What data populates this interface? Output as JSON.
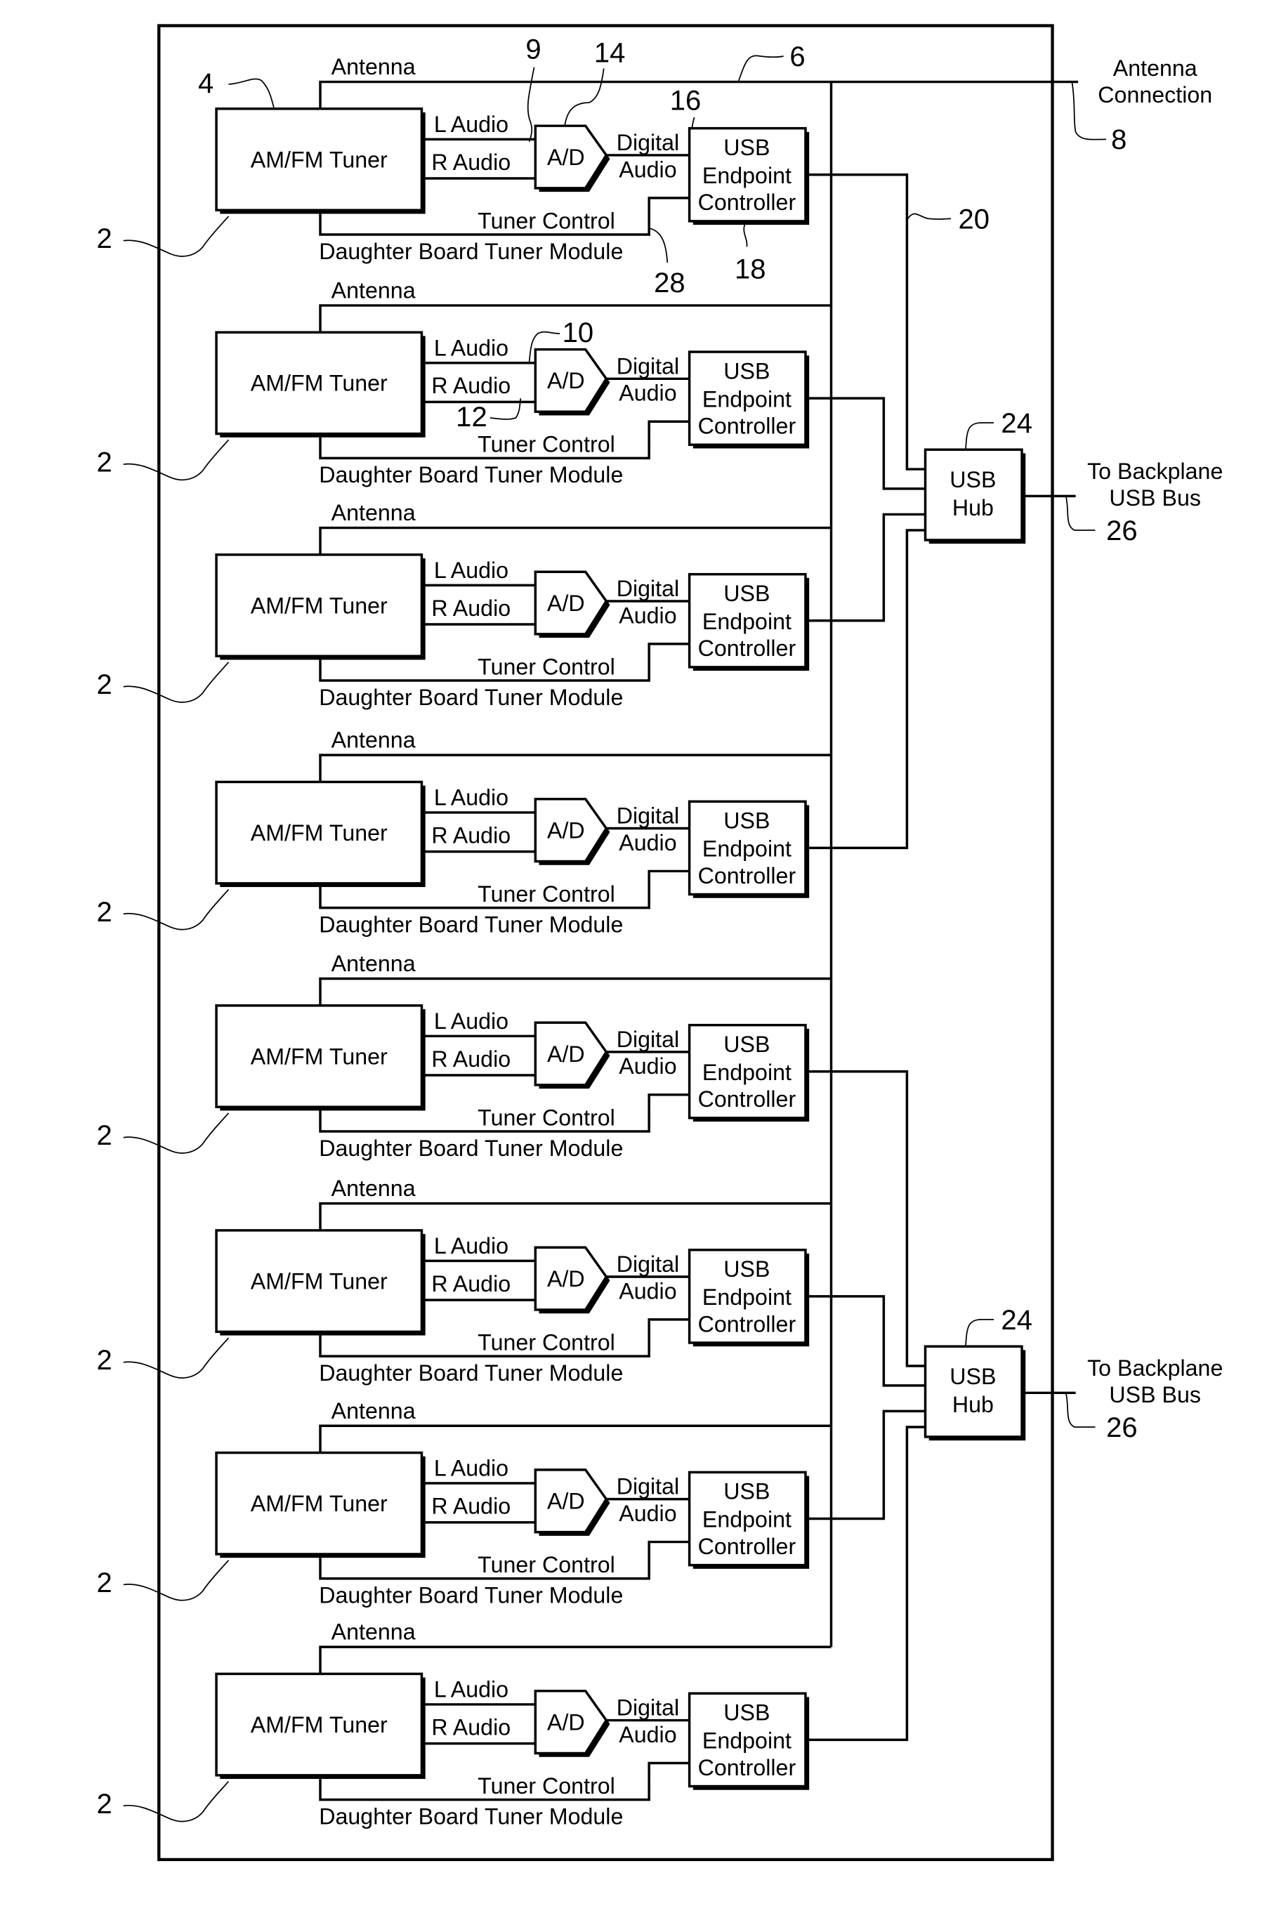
{
  "figure": {
    "module_count": 8,
    "module": {
      "tuner_label": "AM/FM Tuner",
      "antenna_label": "Antenna",
      "l_audio_label": "L Audio",
      "r_audio_label": "R Audio",
      "ad_label": "A/D",
      "digital_audio_label_line1": "Digital",
      "digital_audio_label_line2": "Audio",
      "usb_ec_line1": "USB",
      "usb_ec_line2": "Endpoint",
      "usb_ec_line3": "Controller",
      "tuner_control_label": "Tuner Control",
      "module_label": "Daughter Board Tuner Module",
      "module_ref": "2"
    },
    "hubs": [
      {
        "line1": "USB",
        "line2": "Hub",
        "ref": "24",
        "out_line1": "To Backplane",
        "out_line2": "USB Bus",
        "out_ref": "26",
        "connected_modules": [
          1,
          2,
          3,
          4
        ]
      },
      {
        "line1": "USB",
        "line2": "Hub",
        "ref": "24",
        "out_line1": "To Backplane",
        "out_line2": "USB Bus",
        "out_ref": "26",
        "connected_modules": [
          5,
          6,
          7,
          8
        ]
      }
    ],
    "antenna_connection": {
      "line1": "Antenna",
      "line2": "Connection",
      "ref": "8"
    },
    "reference_numerals": {
      "tuner": "4",
      "antenna_bus": "6",
      "l_audio": "9",
      "l_audio_alt": "10",
      "r_audio": "12",
      "ad_converter": "14",
      "digital_audio": "16",
      "usb_endpoint_controller": "18",
      "usb_link": "20",
      "tuner_control": "28"
    }
  }
}
